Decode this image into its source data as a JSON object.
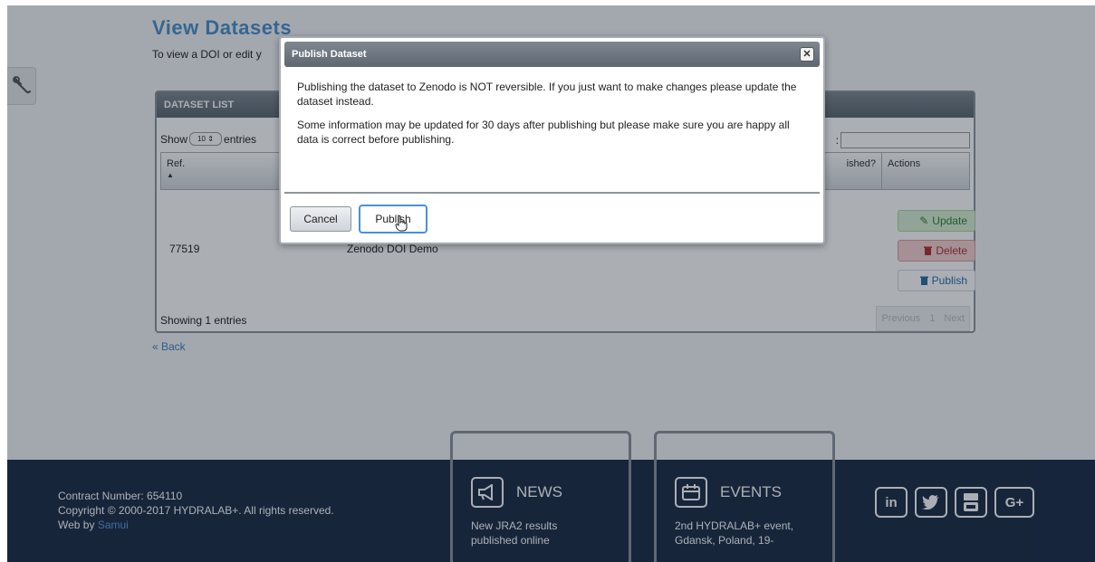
{
  "page": {
    "title": "View Datasets",
    "intro": "To view a DOI or edit y"
  },
  "dataset_list": {
    "header": "DATASET LIST",
    "show_label": "Show",
    "entries_value": "10",
    "entries_label": "entries",
    "search_label": ":",
    "columns": {
      "ref": "Ref.",
      "published": "ished?",
      "actions": "Actions"
    },
    "rows": [
      {
        "ref": "77519",
        "title": "Zenodo DOI Demo"
      }
    ],
    "buttons": {
      "update": "Update",
      "delete": "Delete",
      "publish": "Publish"
    },
    "showing": "Showing 1 entries",
    "pager": {
      "previous": "Previous",
      "page": "1",
      "next": "Next"
    }
  },
  "back_link": "« Back",
  "footer": {
    "contract": "Contract Number: 654110",
    "copyright": "Copyright © 2000-2017 HYDRALAB+. All rights reserved.",
    "web_by_label": "Web by",
    "web_by_name": "Samui",
    "news": {
      "title": "NEWS",
      "text": "New JRA2 results published online"
    },
    "events": {
      "title": "EVENTS",
      "text": "2nd HYDRALAB+ event, Gdansk, Poland, 19-"
    },
    "social": [
      "in",
      "G+"
    ]
  },
  "modal": {
    "title": "Publish Dataset",
    "close_glyph": "✕",
    "paragraph1": "Publishing the dataset to Zenodo is NOT reversible. If you just want to make changes please update the dataset instead.",
    "paragraph2": "Some information may be updated for 30 days after publishing but please make sure you are happy all data is correct before publishing.",
    "cancel_label": "Cancel",
    "publish_label": "Publish"
  },
  "colors": {
    "title_blue": "#4a8fc9",
    "footer_navy": "#1c2b46",
    "update_green": "#2e7d32",
    "delete_red": "#b03030",
    "publish_blue": "#2d6aa3",
    "focus_blue": "#4a90d9"
  },
  "icons": [
    "wrench-icon",
    "megaphone-icon",
    "calendar-icon",
    "linkedin-icon",
    "twitter-icon",
    "youtube-icon",
    "googleplus-icon",
    "pencil-icon",
    "trash-icon",
    "close-icon",
    "hand-cursor-icon"
  ]
}
